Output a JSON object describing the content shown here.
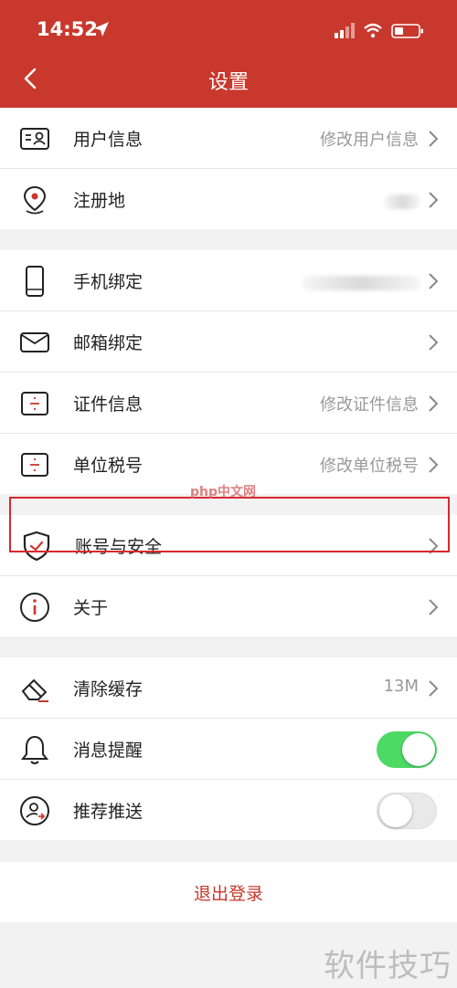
{
  "status_bar": {
    "time": "14:52"
  },
  "header": {
    "title": "设置"
  },
  "group1": [
    {
      "label": "用户信息",
      "value": "修改用户信息",
      "icon": "id-card-icon"
    },
    {
      "label": "注册地",
      "value": "",
      "icon": "location-pin-icon"
    }
  ],
  "group2": [
    {
      "label": "手机绑定",
      "value": "",
      "icon": "phone-icon"
    },
    {
      "label": "邮箱绑定",
      "value": "",
      "icon": "mail-icon"
    },
    {
      "label": "证件信息",
      "value": "修改证件信息",
      "icon": "document-icon"
    },
    {
      "label": "单位税号",
      "value": "修改单位税号",
      "icon": "document-icon"
    },
    {
      "label": "账号与安全",
      "value": "",
      "icon": "shield-icon"
    },
    {
      "label": "关于",
      "value": "",
      "icon": "info-icon"
    }
  ],
  "group3": [
    {
      "label": "清除缓存",
      "value": "13M",
      "icon": "eraser-icon"
    },
    {
      "label": "消息提醒",
      "toggle": true,
      "icon": "bell-icon"
    },
    {
      "label": "推荐推送",
      "toggle": false,
      "icon": "user-push-icon"
    }
  ],
  "logout": {
    "label": "退出登录"
  },
  "watermarks": {
    "php": "php中文网",
    "corner": "软件技巧"
  },
  "colors": {
    "brand": "#c8382d",
    "toggle_on": "#4cd964",
    "highlight": "#d8282f"
  }
}
